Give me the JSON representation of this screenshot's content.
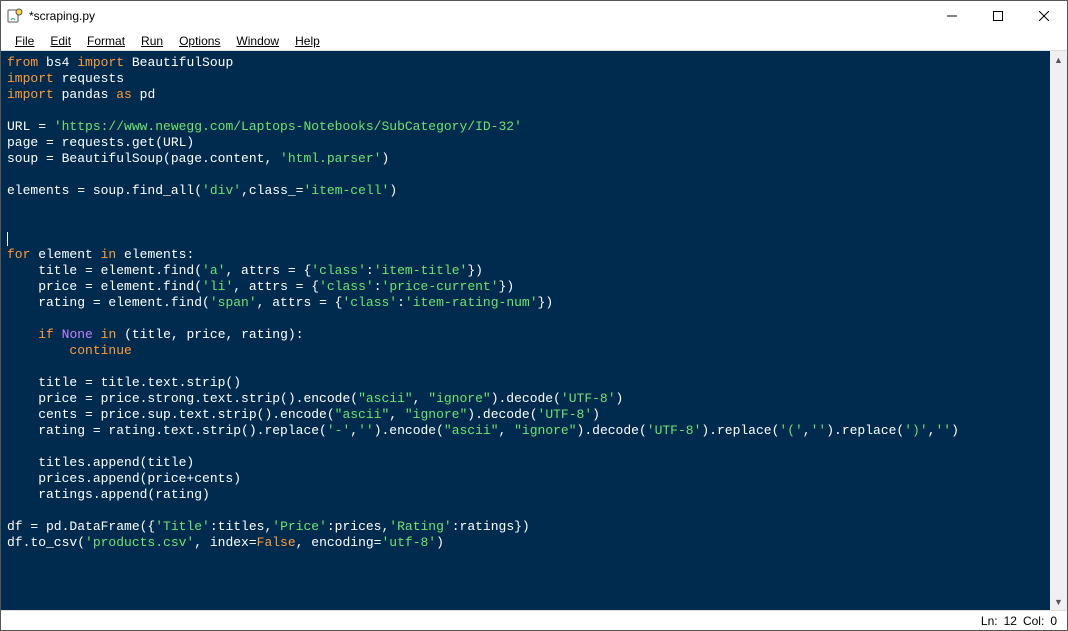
{
  "window": {
    "title": "*scraping.py"
  },
  "menu": {
    "file": "File",
    "edit": "Edit",
    "format": "Format",
    "run": "Run",
    "options": "Options",
    "window": "Window",
    "help": "Help"
  },
  "status": {
    "ln_label": "Ln:",
    "ln": "12",
    "col_label": "Col:",
    "col": "0"
  },
  "code": {
    "l1a": "from",
    "l1b": " bs4 ",
    "l1c": "import",
    "l1d": " BeautifulSoup",
    "l2a": "import",
    "l2b": " requests",
    "l3a": "import",
    "l3b": " pandas ",
    "l3c": "as",
    "l3d": " pd",
    "l5a": "URL = ",
    "l5b": "'https://www.newegg.com/Laptops-Notebooks/SubCategory/ID-32'",
    "l6": "page = requests.get(URL)",
    "l7a": "soup = BeautifulSoup(page.content, ",
    "l7b": "'html.parser'",
    "l7c": ")",
    "l9a": "elements = soup.find_all(",
    "l9b": "'div'",
    "l9c": ",class_=",
    "l9d": "'item-cell'",
    "l9e": ")",
    "l13a": "for",
    "l13b": " element ",
    "l13c": "in",
    "l13d": " elements:",
    "l14a": "    title = element.find(",
    "l14b": "'a'",
    "l14c": ", attrs = {",
    "l14d": "'class'",
    "l14e": ":",
    "l14f": "'item-title'",
    "l14g": "})",
    "l15a": "    price = element.find(",
    "l15b": "'li'",
    "l15c": ", attrs = {",
    "l15d": "'class'",
    "l15e": ":",
    "l15f": "'price-current'",
    "l15g": "})",
    "l16a": "    rating = element.find(",
    "l16b": "'span'",
    "l16c": ", attrs = {",
    "l16d": "'class'",
    "l16e": ":",
    "l16f": "'item-rating-num'",
    "l16g": "})",
    "l18a": "    ",
    "l18b": "if",
    "l18c": " ",
    "l18d": "None",
    "l18e": " ",
    "l18f": "in",
    "l18g": " (title, price, rating):",
    "l19a": "        ",
    "l19b": "continue",
    "l21": "    title = title.text.strip()",
    "l22a": "    price = price.strong.text.strip().encode(",
    "l22b": "\"ascii\"",
    "l22c": ", ",
    "l22d": "\"ignore\"",
    "l22e": ").decode(",
    "l22f": "'UTF-8'",
    "l22g": ")",
    "l23a": "    cents = price.sup.text.strip().encode(",
    "l23b": "\"ascii\"",
    "l23c": ", ",
    "l23d": "\"ignore\"",
    "l23e": ").decode(",
    "l23f": "'UTF-8'",
    "l23g": ")",
    "l24a": "    rating = rating.text.strip().replace(",
    "l24b": "'-'",
    "l24c": ",",
    "l24d": "''",
    "l24e": ").encode(",
    "l24f": "\"ascii\"",
    "l24g": ", ",
    "l24h": "\"ignore\"",
    "l24i": ").decode(",
    "l24j": "'UTF-8'",
    "l24k": ").replace(",
    "l24l": "'('",
    "l24m": ",",
    "l24n": "''",
    "l24o": ").replace(",
    "l24p": "')'",
    "l24q": ",",
    "l24r": "''",
    "l24s": ")",
    "l26": "    titles.append(title)",
    "l27": "    prices.append(price+cents)",
    "l28": "    ratings.append(rating)",
    "l30a": "df = pd.DataFrame({",
    "l30b": "'Title'",
    "l30c": ":titles,",
    "l30d": "'Price'",
    "l30e": ":prices,",
    "l30f": "'Rating'",
    "l30g": ":ratings})",
    "l31a": "df.to_csv(",
    "l31b": "'products.csv'",
    "l31c": ", index=",
    "l31d": "False",
    "l31e": ", encoding=",
    "l31f": "'utf-8'",
    "l31g": ")"
  }
}
